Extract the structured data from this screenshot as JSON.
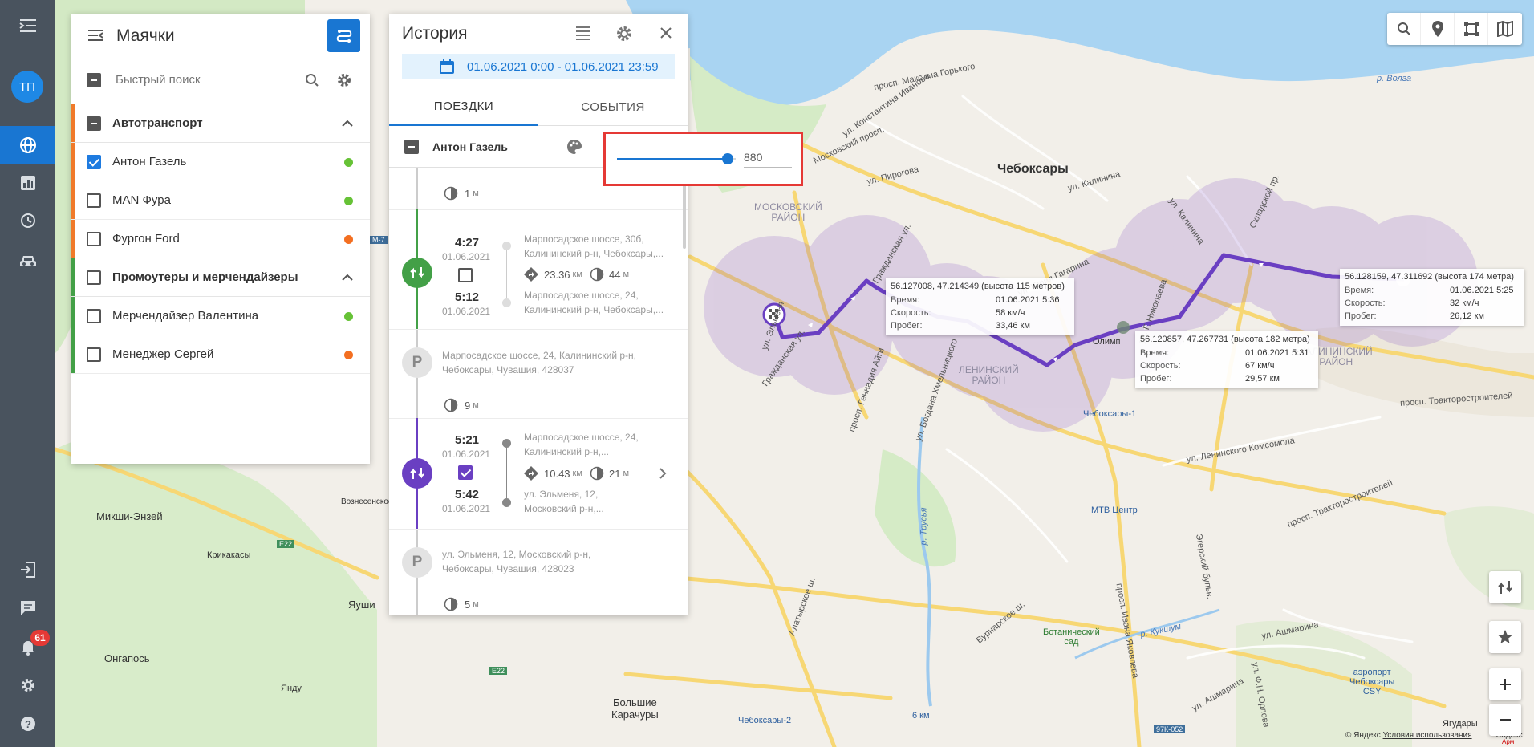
{
  "rail": {
    "avatar_initials": "ТП",
    "notifications_count": "61"
  },
  "beacons": {
    "title": "Маячки",
    "search_placeholder": "Быстрый поиск",
    "groups": [
      {
        "name": "Автотранспорт",
        "color": "#f07a2a",
        "items": [
          {
            "name": "Антон Газель",
            "checked": true,
            "status": "#4caf50"
          },
          {
            "name": "MAN Фура",
            "checked": false,
            "status": "#4caf50"
          },
          {
            "name": "Фургон Ford",
            "checked": false,
            "status": "#f07a2a"
          }
        ]
      },
      {
        "name": "Промоутеры и мерчендайзеры",
        "color": "#43a047",
        "items": [
          {
            "name": "Мерчендайзер Валентина",
            "checked": false,
            "status": "#4caf50"
          },
          {
            "name": "Менеджер Сергей",
            "checked": false,
            "status": "#f07a2a"
          }
        ]
      }
    ]
  },
  "history": {
    "title": "История",
    "date_range": "01.06.2021 0:00 - 01.06.2021 23:59",
    "tabs": [
      "ПОЕЗДКИ",
      "СОБЫТИЯ"
    ],
    "vehicle": "Антон Газель",
    "slider_value": "880",
    "slider_fraction": 0.93,
    "entries": [
      {
        "type": "duration",
        "value": "1",
        "unit": "м"
      },
      {
        "type": "trip",
        "color": "#43a047",
        "checked": false,
        "start_time": "4:27",
        "start_date": "01.06.2021",
        "end_time": "5:12",
        "end_date": "01.06.2021",
        "from_addr": [
          "Марпосадское шоссе, 30б,",
          "Калининский р-н, Чебоксары,..."
        ],
        "to_addr": [
          "Марпосадское шоссе, 24,",
          "Калининский р-н, Чебоксары,..."
        ],
        "distance": "23.36",
        "distance_unit": "км",
        "duration": "44",
        "duration_unit": "м"
      },
      {
        "type": "parking",
        "letter": "P",
        "addr": [
          "Марпосадское шоссе, 24, Калининский р-н,",
          "Чебоксары, Чувашия, 428037"
        ]
      },
      {
        "type": "duration",
        "value": "9",
        "unit": "м"
      },
      {
        "type": "trip",
        "color": "#6a3fc2",
        "checked": true,
        "start_time": "5:21",
        "start_date": "01.06.2021",
        "end_time": "5:42",
        "end_date": "01.06.2021",
        "from_addr": [
          "Марпосадское шоссе, 24,",
          "Калининский р-н,..."
        ],
        "to_addr": [
          "ул. Эльменя, 12,",
          "Московский р-н,..."
        ],
        "distance": "10.43",
        "distance_unit": "км",
        "duration": "21",
        "duration_unit": "м"
      },
      {
        "type": "parking",
        "letter": "P",
        "addr": [
          "ул. Эльменя, 12, Московский р-н,",
          "Чебоксары, Чувашия, 428023"
        ]
      },
      {
        "type": "duration",
        "value": "5",
        "unit": "м"
      }
    ]
  },
  "tooltips": [
    {
      "title": "56.127008, 47.214349 (высота 115 метров)",
      "rows": [
        [
          "Время:",
          "01.06.2021 5:36"
        ],
        [
          "Скорость:",
          "58 км/ч"
        ],
        [
          "Пробег:",
          "33,46 км"
        ]
      ]
    },
    {
      "title": "56.120857, 47.267731 (высота 182 метра)",
      "rows": [
        [
          "Время:",
          "01.06.2021 5:31"
        ],
        [
          "Скорость:",
          "67 км/ч"
        ],
        [
          "Пробег:",
          "29,57 км"
        ]
      ]
    },
    {
      "title": "56.128159, 47.311692 (высота 174 метра)",
      "rows": [
        [
          "Время:",
          "01.06.2021 5:25"
        ],
        [
          "Скорость:",
          "32 км/ч"
        ],
        [
          "Пробег:",
          "26,12 км"
        ]
      ]
    }
  ],
  "map_labels": {
    "city": "Чебоксары",
    "district_moscow": "МОСКОВСКИЙ\nРАЙОН",
    "district_lenin": "ЛЕНИНСКИЙ\nРАЙОН",
    "district_kalinin": "КАЛИНИНСКИЙ\nРАЙОН",
    "volga": "р. Волга",
    "kukshum": "р. Кукшум",
    "trusya": "р. Трусья",
    "st1": "Чебоксары-1",
    "st2": "Чебоксары-2",
    "mtv": "МТВ Центр",
    "botanic": "Ботанический\nсад",
    "airport": "аэропорт\nЧебоксары\nCSY",
    "big_karachury": "Большие\nКарачуры",
    "miksh": "Микши-Энзей",
    "krikakasy": "Крикакасы",
    "yaushi": "Яуши",
    "ongapos": "Онгапось",
    "yandy": "Янду",
    "vozn": "Вознесенское",
    "yagudary": "Ягудары",
    "olimp": "Олимп",
    "street_gorky": "просп. Максима Горького",
    "street_ivanova": "ул. Константина Иванова",
    "street_moskovsky": "Московский просп.",
    "street_pirogova": "ул. Пирогова",
    "street_kalinina": "ул. Калинина",
    "street_kalinina2": "ул. Калинина",
    "street_skladskoy": "Складской пр.",
    "street_tractor": "просп. Тракторостроителей",
    "street_tractor2": "просп. Тракторостроителей",
    "street_lenkoms": "ул. Ленинского Комсомола",
    "street_yakovlev": "просп. Ивана Яковлева",
    "street_ashmarina": "ул. Ашмарина",
    "street_ashmarina2": "ул. Ашмарина",
    "street_ortova": "ул. Ф.Н. Орлова",
    "street_erzer": "Эгерский бульв.",
    "street_vurnar": "Вурнарское ш.",
    "street_alatyr": "Алатырское ш.",
    "street_gagarina": "ул. Юрия Гагарина",
    "street_nikolaeva": "ул. Г. Николаева",
    "street_gennadiy": "просп. Геннадия Айги",
    "street_khmel": "ул. Богдана Хмельницкого",
    "street_grazhd": "Гражданская ул.",
    "street_grazhd2": "Гражданская ул.",
    "street_elmenya": "ул. Эльменя",
    "e22": "E22",
    "e22b": "E22",
    "r97k": "97К-052",
    "km6": "6 км",
    "m7": "М-7",
    "copyright": "© Яндекс",
    "terms": "Условия использования",
    "yandex": "Яндекс",
    "armalive": "Арм"
  },
  "colors": {
    "accent": "#1976d2",
    "route": "#6a3fc2",
    "rail": "#49535e",
    "highlight": "#e53935"
  }
}
